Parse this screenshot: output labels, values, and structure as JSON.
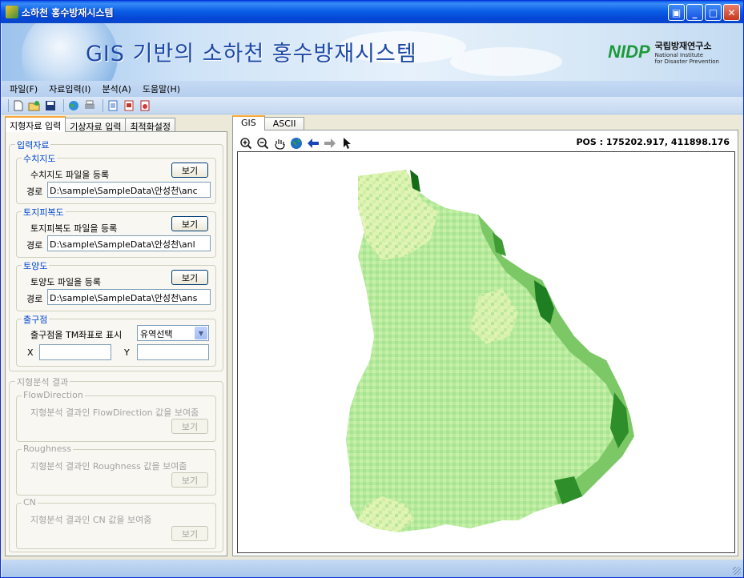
{
  "window": {
    "title": "소하천 홍수방재시스템"
  },
  "banner": {
    "title": "GIS 기반의 소하천 홍수방재시스템",
    "logo_mark": "NIDP",
    "logo_name_ko": "국립방재연구소",
    "logo_name_en_1": "National Institute",
    "logo_name_en_2": "for Disaster Prevention"
  },
  "menu": {
    "items": [
      "파일(F)",
      "자료입력(I)",
      "분석(A)",
      "도움말(H)"
    ]
  },
  "toolbar": {
    "icons": [
      "new-icon",
      "open-icon",
      "save-icon",
      "globe-icon",
      "print-icon",
      "document-icon",
      "report-icon",
      "pdf-icon"
    ]
  },
  "left_tabs": {
    "items": [
      "지형자료 입력",
      "기상자료 입력",
      "최적화설정"
    ]
  },
  "input_section": {
    "label": "입력자료",
    "dem": {
      "label": "수치지도",
      "register": "수치지도 파일을 등록",
      "button": "보기",
      "path_label": "경로",
      "path_value": "D:\\sample\\SampleData\\안성천\\anc"
    },
    "landcover": {
      "label": "토지피복도",
      "register": "토지피복도 파일을 등록",
      "button": "보기",
      "path_label": "경로",
      "path_value": "D:\\sample\\SampleData\\안성천\\anl"
    },
    "soil": {
      "label": "토양도",
      "register": "토양도 파일을 등록",
      "button": "보기",
      "path_label": "경로",
      "path_value": "D:\\sample\\SampleData\\안성천\\ans"
    },
    "outlet": {
      "label": "출구점",
      "tm_label": "출구점을 TM좌표로 표시",
      "select_value": "유역선택",
      "x_label": "X",
      "y_label": "Y",
      "x_value": "",
      "y_value": ""
    }
  },
  "result_section": {
    "label": "지형분석 결과",
    "flow": {
      "label": "FlowDirection",
      "desc": "지형분석 결과인 FlowDirection 값을 보여줌",
      "button": "보기"
    },
    "rough": {
      "label": "Roughness",
      "desc": "지형분석 결과인 Roughness 값을 보여줌",
      "button": "보기"
    },
    "cn": {
      "label": "CN",
      "desc": "지형분석 결과인  CN 값을 보여줌",
      "button": "보기"
    }
  },
  "map_tabs": {
    "items": [
      "GIS",
      "ASCII"
    ]
  },
  "map": {
    "tools": [
      "zoom-in-icon",
      "zoom-out-icon",
      "pan-hand-icon",
      "globe-icon",
      "back-arrow-icon",
      "forward-arrow-icon",
      "pointer-icon"
    ],
    "pos_text": "POS : 175202.917, 411898.176",
    "colors": {
      "pale": "#e8f5b8",
      "light": "#b9ec9e",
      "mid": "#8fd47a",
      "dark": "#2e8f2a",
      "darkest": "#156b17"
    }
  }
}
